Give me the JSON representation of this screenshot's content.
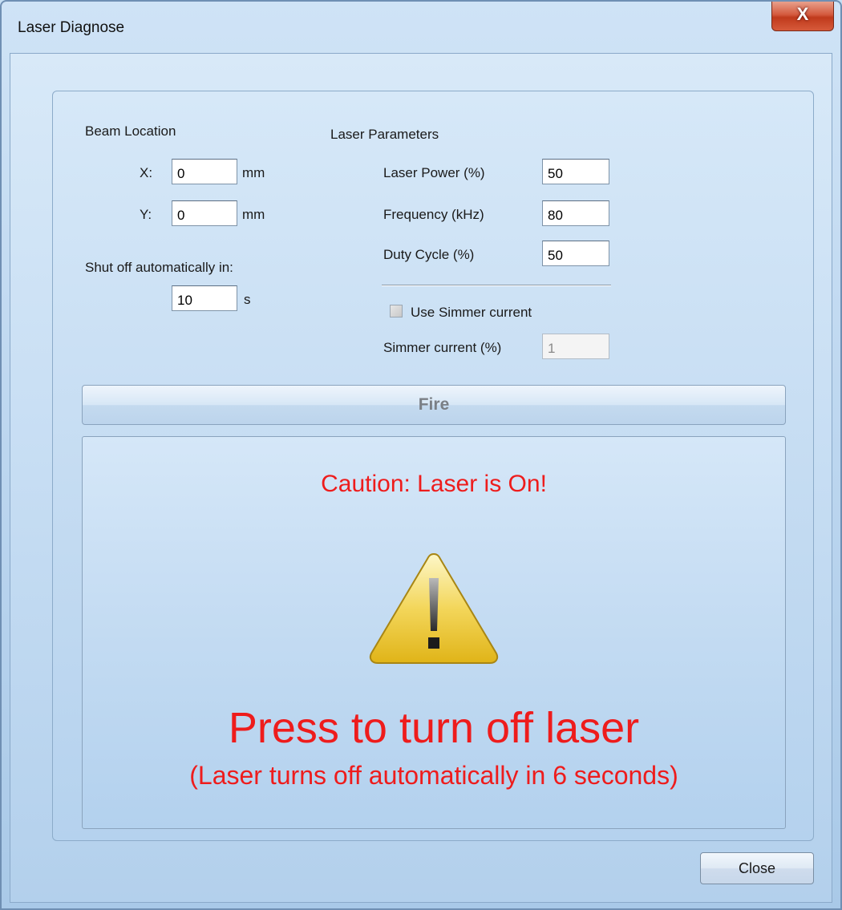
{
  "window": {
    "title": "Laser Diagnose",
    "close_glyph": "X"
  },
  "beam_location": {
    "heading": "Beam Location",
    "x_label": "X:",
    "x_value": "0",
    "x_unit": "mm",
    "y_label": "Y:",
    "y_value": "0",
    "y_unit": "mm"
  },
  "shutoff": {
    "label": "Shut off automatically in:",
    "value": "10",
    "unit": "s"
  },
  "laser_parameters": {
    "heading": "Laser Parameters",
    "power_label": "Laser Power (%)",
    "power_value": "50",
    "frequency_label": "Frequency (kHz)",
    "frequency_value": "80",
    "duty_label": "Duty Cycle (%)",
    "duty_value": "50",
    "use_simmer_label": "Use Simmer current",
    "use_simmer_checked": false,
    "simmer_label": "Simmer current (%)",
    "simmer_value": "1"
  },
  "fire_button": {
    "label": "Fire"
  },
  "warning": {
    "caution": "Caution: Laser is On!",
    "press": "Press to turn off laser",
    "auto": "(Laser turns off automatically in 6 seconds)",
    "icon": "warning-triangle-icon"
  },
  "close_button": {
    "label": "Close"
  },
  "colors": {
    "alert_red": "#ee1c1c",
    "close_red": "#c03a1c",
    "window_blue": "#bcd6ef"
  }
}
